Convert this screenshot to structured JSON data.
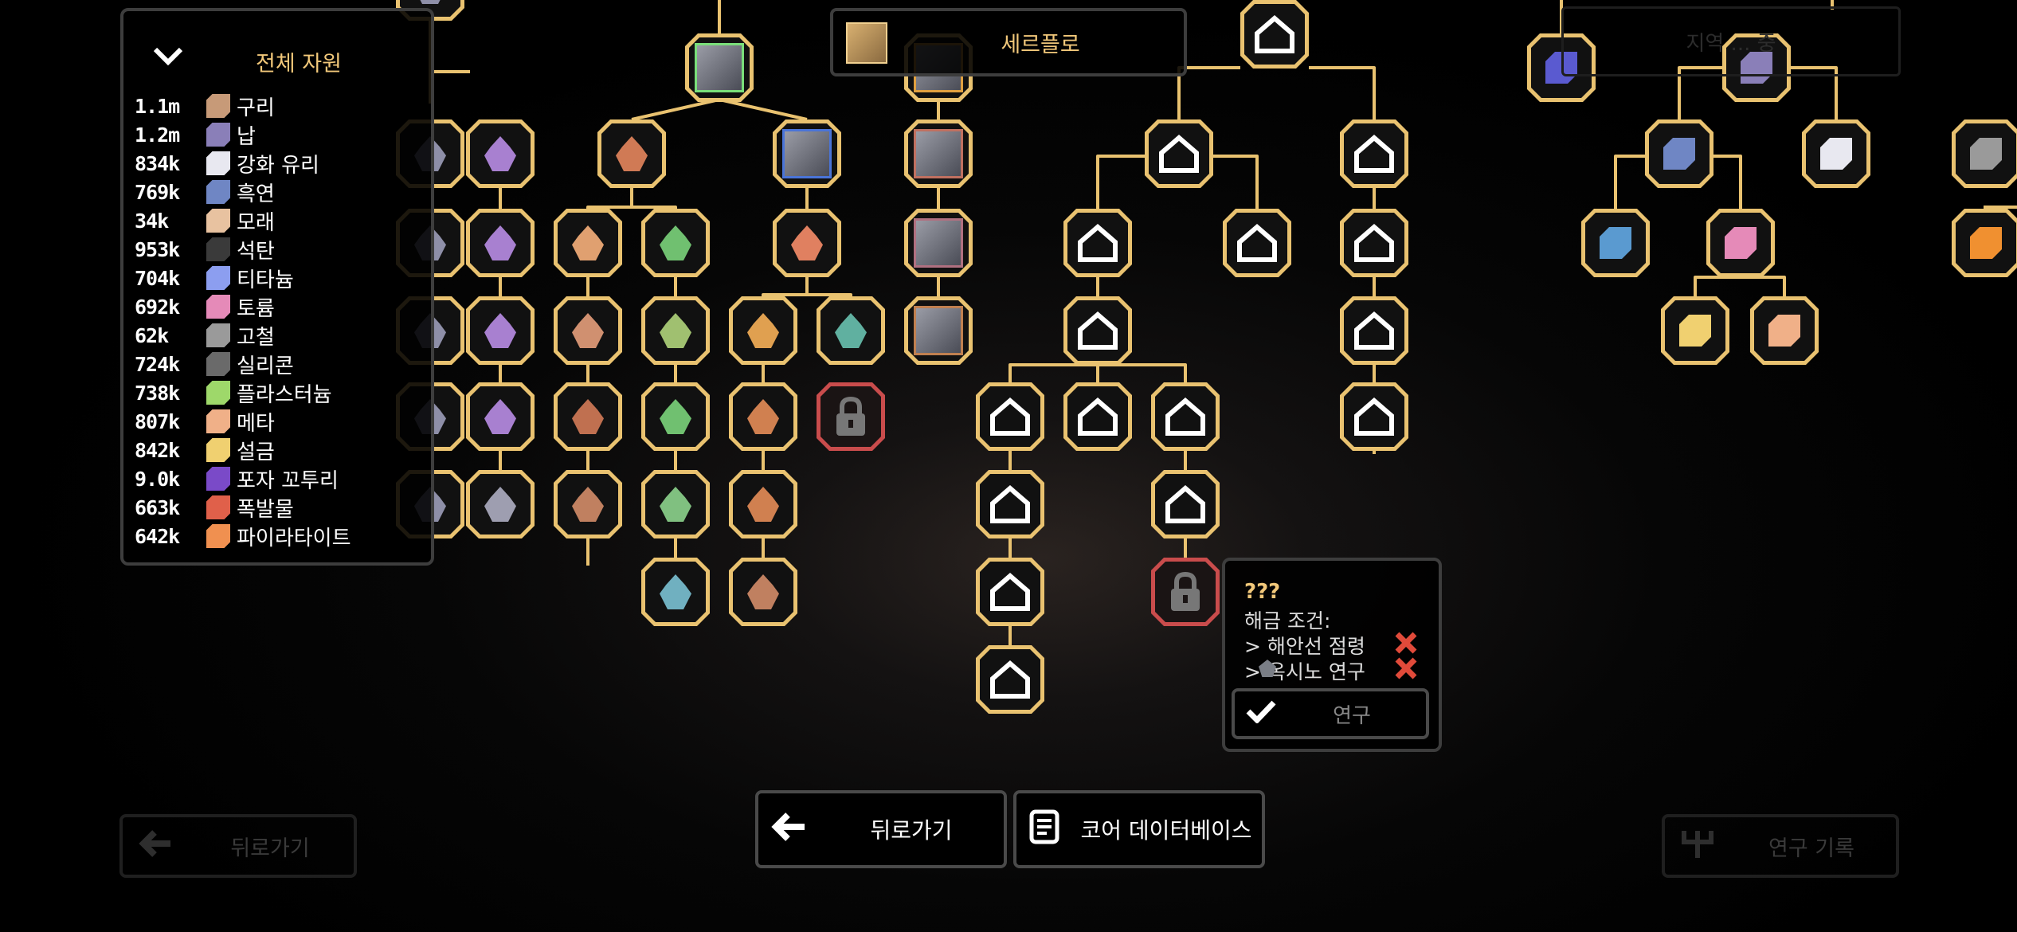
{
  "resources_panel": {
    "title": "전체 자원",
    "items": [
      {
        "amount": "1.1m",
        "name": "구리",
        "color": "#c79a78"
      },
      {
        "amount": "1.2m",
        "name": "납",
        "color": "#8a7fb8"
      },
      {
        "amount": "834k",
        "name": "강화 유리",
        "color": "#e8e8f0"
      },
      {
        "amount": "769k",
        "name": "흑연",
        "color": "#6f86c4"
      },
      {
        "amount": "34k",
        "name": "모래",
        "color": "#e8c2a0"
      },
      {
        "amount": "953k",
        "name": "석탄",
        "color": "#3a3a3a"
      },
      {
        "amount": "704k",
        "name": "티타늄",
        "color": "#8c9ef0"
      },
      {
        "amount": "692k",
        "name": "토륨",
        "color": "#e58ab8"
      },
      {
        "amount": "62k",
        "name": "고철",
        "color": "#9a9a9a"
      },
      {
        "amount": "724k",
        "name": "실리콘",
        "color": "#6a6a6a"
      },
      {
        "amount": "738k",
        "name": "플라스터늄",
        "color": "#9ed86a"
      },
      {
        "amount": "807k",
        "name": "메타",
        "color": "#f0b088"
      },
      {
        "amount": "842k",
        "name": "설금",
        "color": "#f0d070"
      },
      {
        "amount": "9.0k",
        "name": "포자 꼬투리",
        "color": "#7a4ac8"
      },
      {
        "amount": "663k",
        "name": "폭발물",
        "color": "#e0604a"
      },
      {
        "amount": "642k",
        "name": "파이라타이트",
        "color": "#f09050"
      }
    ]
  },
  "top_label": {
    "name": "세르플로"
  },
  "background_label": {
    "text": "지역 ... 중"
  },
  "tooltip": {
    "title": "???",
    "condition_header": "해금 조건:",
    "conditions": [
      {
        "text": "> 해안선 점령",
        "met": false
      },
      {
        "text": "> 옥시노 연구",
        "met": false
      }
    ],
    "research_button": "연구"
  },
  "buttons": {
    "back": "뒤로가기",
    "core_database": "코어 데이터베이스",
    "back_dim": "뒤로가기",
    "research_log_dim": "연구 기록"
  },
  "colors": {
    "node_border": "#e9c270",
    "locked_border": "#c94c4c",
    "line": "#e9c270"
  }
}
